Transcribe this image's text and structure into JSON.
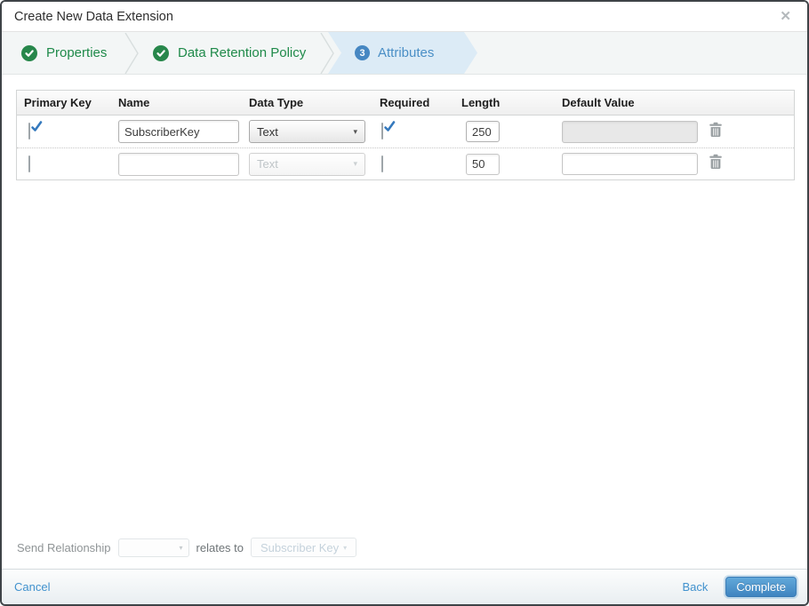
{
  "modal": {
    "title": "Create New Data Extension",
    "close_icon": "✕"
  },
  "wizard": {
    "steps": [
      {
        "label": "Properties",
        "state": "complete"
      },
      {
        "label": "Data Retention Policy",
        "state": "complete"
      },
      {
        "label": "Attributes",
        "state": "active",
        "number": "3"
      }
    ]
  },
  "table": {
    "headers": {
      "primary_key": "Primary Key",
      "name": "Name",
      "data_type": "Data Type",
      "required": "Required",
      "length": "Length",
      "default_value": "Default Value"
    },
    "rows": [
      {
        "primary_key_checked": true,
        "name": "SubscriberKey",
        "data_type": "Text",
        "data_type_disabled": false,
        "required_checked": true,
        "required_disabled": true,
        "length": "250",
        "default_value": "",
        "default_value_disabled": true
      },
      {
        "primary_key_checked": false,
        "name": "",
        "data_type": "Text",
        "data_type_disabled": true,
        "required_checked": false,
        "required_disabled": false,
        "length": "50",
        "default_value": "",
        "default_value_disabled": false
      }
    ]
  },
  "send_relationship": {
    "label": "Send Relationship",
    "selected_value": "",
    "relates_to_label": "relates to",
    "target_field": "Subscriber Key"
  },
  "footer": {
    "cancel_label": "Cancel",
    "back_label": "Back",
    "complete_label": "Complete"
  },
  "icons": {
    "dropdown_arrow": "▾"
  },
  "colors": {
    "step_complete_green": "#27874b",
    "step_active_blue": "#4687c2",
    "step_active_bg": "#dcebf6",
    "link_blue": "#4192ce",
    "complete_button_top": "#62a9da",
    "complete_button_bottom": "#3f84c0",
    "modal_border": "#3e4347"
  }
}
